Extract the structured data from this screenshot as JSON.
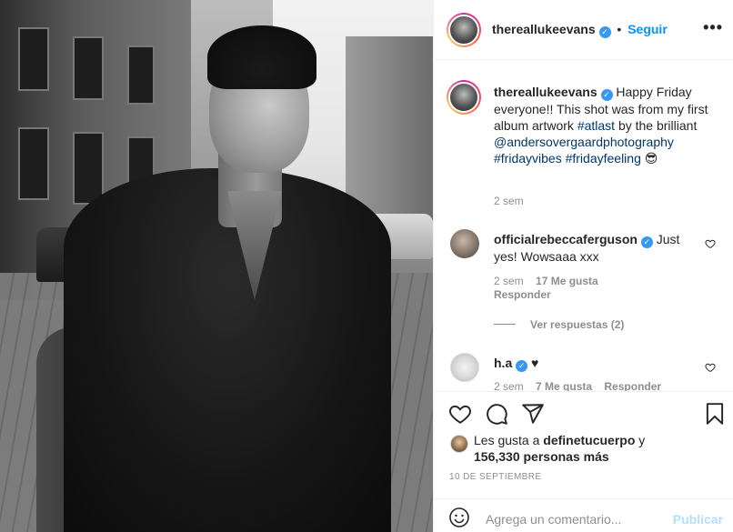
{
  "post": {
    "username": "thereallukeevans",
    "follow_label": "Seguir",
    "dot": "•",
    "more": "•••"
  },
  "caption": {
    "username": "thereallukeevans",
    "text_1": "Happy Friday everyone!! This shot was from my first album artwork ",
    "hashtag_1": "#atlast",
    "text_2": " by the brilliant ",
    "mention": "@andersovergaardphotography",
    "hashtag_2": "#fridayvibes",
    "hashtag_3": "#fridayfeeling",
    "emoji": "😎",
    "time": "2 sem"
  },
  "comments": [
    {
      "username": "officialrebeccaferguson",
      "text": "Just yes! Wowsaaa xxx",
      "time": "2 sem",
      "likes": "17 Me gusta",
      "reply": "Responder",
      "view_replies": "Ver respuestas (2)"
    },
    {
      "username": "h.a",
      "text": "♥",
      "time": "2 sem",
      "likes": "7 Me gusta",
      "reply": "Responder"
    }
  ],
  "likes": {
    "prefix": "Les gusta a",
    "user": "definetucuerpo",
    "conj": "y",
    "count": "156,330 personas más"
  },
  "date": "10 DE SEPTIEMBRE",
  "add_comment": {
    "placeholder": "Agrega un comentario...",
    "publish": "Publicar"
  },
  "colors": {
    "accent": "#0095f6",
    "verified": "#3897f0",
    "link": "#00376b",
    "muted": "#8e8e8e",
    "publish_disabled": "#b2dffc"
  },
  "icons": [
    "heart-icon",
    "comment-icon",
    "share-icon",
    "bookmark-icon",
    "emoji-icon",
    "more-icon",
    "verified-icon"
  ]
}
